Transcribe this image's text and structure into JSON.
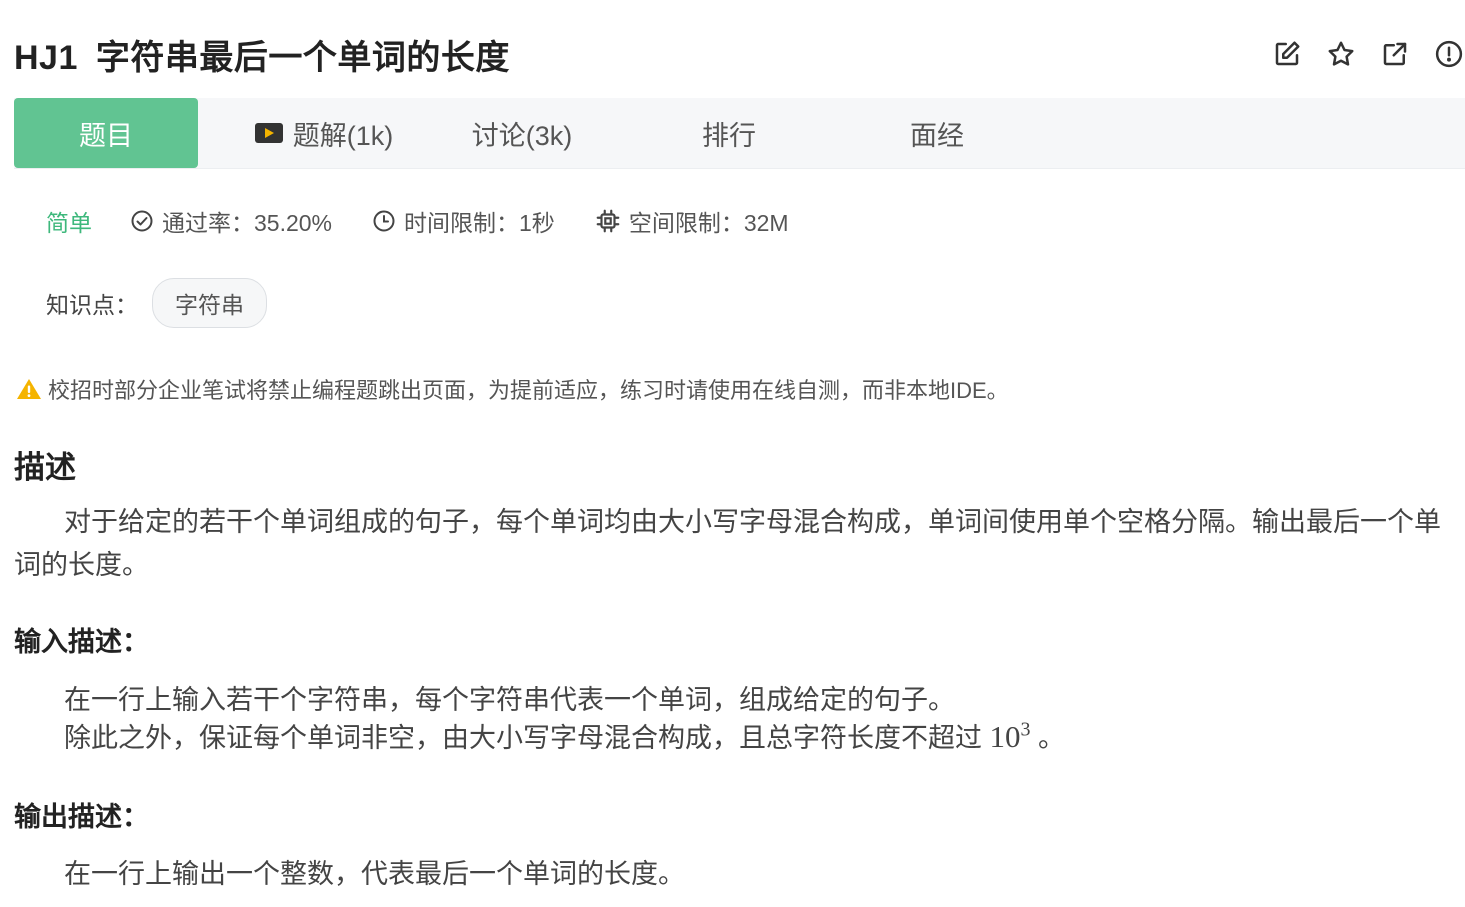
{
  "problem": {
    "code": "HJ1",
    "title": "字符串最后一个单词的长度"
  },
  "header_icons": [
    "edit-icon",
    "star-icon",
    "share-icon",
    "report-icon"
  ],
  "tabs": [
    {
      "label": "题目",
      "active": true
    },
    {
      "label": "题解(1k)",
      "icon": "video-icon"
    },
    {
      "label": "讨论(3k)"
    },
    {
      "label": "排行"
    },
    {
      "label": "面经"
    }
  ],
  "meta": {
    "difficulty": "简单",
    "pass_rate": "通过率：35.20%",
    "time_limit": "时间限制：1秒",
    "space_limit": "空间限制：32M"
  },
  "knowledge": {
    "label": "知识点：",
    "tag": "字符串"
  },
  "warning": "校招时部分企业笔试将禁止编程题跳出页面，为提前适应，练习时请使用在线自测，而非本地IDE。",
  "description": {
    "heading": "描述",
    "text": "对于给定的若干个单词组成的句子，每个单词均由大小写字母混合构成，单词间使用单个空格分隔。输出最后一个单词的长度。"
  },
  "input": {
    "heading": "输入描述：",
    "line1": "在一行上输入若干个字符串，每个字符串代表一个单词，组成给定的句子。",
    "line2": "除此之外，保证每个单词非空，由大小写字母混合构成，且总字符长度不超过",
    "math_base": "10",
    "math_exp": "3",
    "line2_end": "。"
  },
  "output": {
    "heading": "输出描述：",
    "line1": "在一行上输出一个整数，代表最后一个单词的长度。"
  },
  "colors": {
    "accent": "#61c492",
    "difficulty_easy": "#3eb87c",
    "warning": "#f5b400"
  }
}
